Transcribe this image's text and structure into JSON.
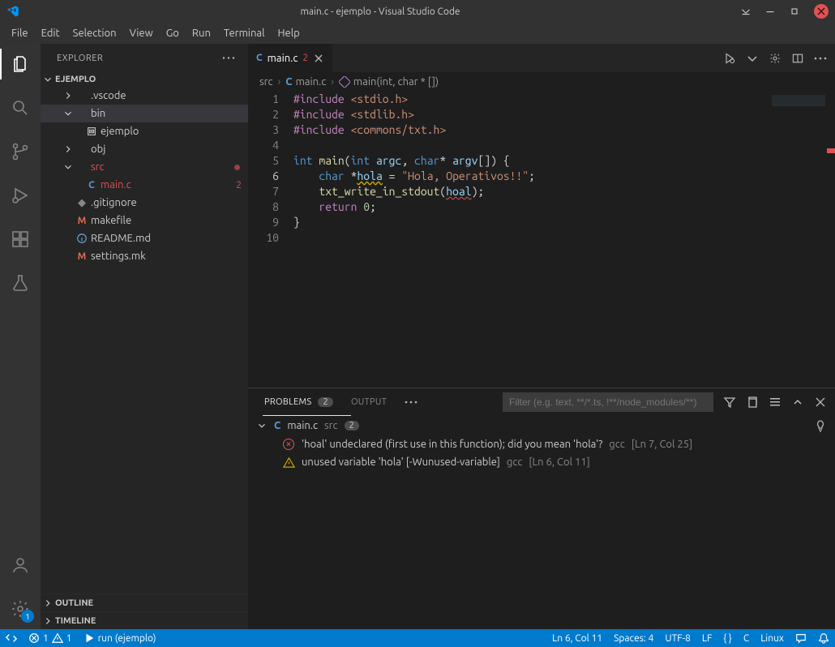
{
  "title": "main.c - ejemplo - Visual Studio Code",
  "menu": [
    "File",
    "Edit",
    "Selection",
    "View",
    "Go",
    "Run",
    "Terminal",
    "Help"
  ],
  "sidebar": {
    "header": "EXPLORER",
    "root": "EJEMPLO",
    "tree": [
      {
        "kind": "folder",
        "name": ".vscode",
        "open": false,
        "indent": 1
      },
      {
        "kind": "folder",
        "name": "bin",
        "open": true,
        "indent": 1,
        "selected": true
      },
      {
        "kind": "file",
        "name": "ejemplo",
        "icon": "binary",
        "indent": 2
      },
      {
        "kind": "folder",
        "name": "obj",
        "open": false,
        "indent": 1
      },
      {
        "kind": "folder",
        "name": "src",
        "open": true,
        "indent": 1,
        "dot": true,
        "error": true
      },
      {
        "kind": "file",
        "name": "main.c",
        "icon": "c",
        "indent": 2,
        "badge": "2",
        "error": true
      },
      {
        "kind": "file",
        "name": ".gitignore",
        "icon": "git",
        "indent": 1
      },
      {
        "kind": "file",
        "name": "makefile",
        "icon": "m",
        "indent": 1
      },
      {
        "kind": "file",
        "name": "README.md",
        "icon": "info",
        "indent": 1
      },
      {
        "kind": "file",
        "name": "settings.mk",
        "icon": "m",
        "indent": 1
      }
    ],
    "sections": [
      "OUTLINE",
      "TIMELINE"
    ]
  },
  "tab": {
    "icon": "C",
    "name": "main.c",
    "badge": "2"
  },
  "breadcrumb": {
    "items": [
      "src",
      "main.c",
      "main(int, char * [])"
    ]
  },
  "code": {
    "lines": [
      {
        "n": 1,
        "html": "<span class='kw'>#include</span> <span class='hdr'>&lt;stdio.h&gt;</span>"
      },
      {
        "n": 2,
        "html": "<span class='kw'>#include</span> <span class='hdr'>&lt;stdlib.h&gt;</span>"
      },
      {
        "n": 3,
        "html": "<span class='kw'>#include</span> <span class='hdr'>&lt;commons/txt.h&gt;</span>"
      },
      {
        "n": 4,
        "html": ""
      },
      {
        "n": 5,
        "html": "<span class='int'>int</span> <span class='fn'>main</span><span class='pun'>(</span><span class='int'>int</span> <span class='id'>argc</span><span class='pun'>,</span> <span class='int'>char</span><span class='pun'>*</span> <span class='id'>argv</span><span class='pun'>[</span><span class='pun'>]</span><span class='pun'>)</span> <span class='pun'>{</span>"
      },
      {
        "n": 6,
        "html": "    <span class='int'>char</span> <span class='pun'>*</span><span class='id wavy-warn'>hola</span> <span class='pun'>=</span> <span class='str'>\"Hola, Operativos!!\"</span><span class='pun'>;</span>",
        "current": true
      },
      {
        "n": 7,
        "html": "    <span class='fn'>txt_write_in_stdout</span><span class='pun'>(</span><span class='id wavy'>hoal</span><span class='pun'>)</span><span class='pun'>;</span>"
      },
      {
        "n": 8,
        "html": "    <span class='kw'>return</span> <span class='num'>0</span><span class='pun'>;</span>"
      },
      {
        "n": 9,
        "html": "<span class='pun'>}</span>"
      },
      {
        "n": 10,
        "html": ""
      }
    ]
  },
  "panel": {
    "tabs": {
      "problems": "PROBLEMS",
      "problems_badge": "2",
      "output": "OUTPUT"
    },
    "filter_placeholder": "Filter (e.g. text, **/*.ts, !**/node_modules/**)",
    "file": {
      "icon": "C",
      "name": "main.c",
      "dir": "src",
      "count": "2"
    },
    "problems": [
      {
        "sev": "error",
        "msg": "'hoal' undeclared (first use in this function); did you mean 'hola'?",
        "src": "gcc",
        "loc": "[Ln 7, Col 25]"
      },
      {
        "sev": "warning",
        "msg": "unused variable 'hola' [-Wunused-variable]",
        "src": "gcc",
        "loc": "[Ln 6, Col 11]"
      }
    ]
  },
  "status": {
    "left": {
      "errors": "1",
      "warnings": "1",
      "task": "run (ejemplo)"
    },
    "right": {
      "pos": "Ln 6, Col 11",
      "spaces": "Spaces: 4",
      "enc": "UTF-8",
      "eol": "LF",
      "lang_icon": "{ }",
      "lang": "C",
      "os": "Linux"
    }
  },
  "activity_badge": "1",
  "labels": {
    "dots": "⋯"
  }
}
